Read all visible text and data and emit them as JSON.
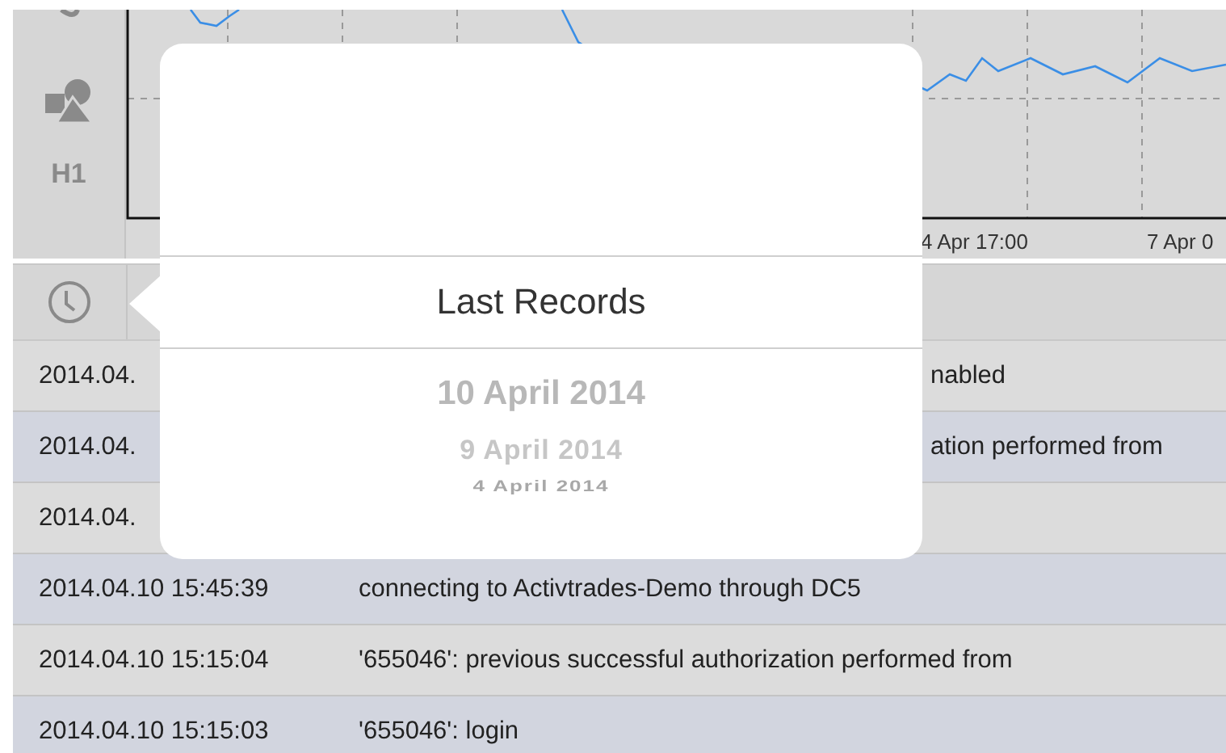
{
  "sidebar": {
    "timeframe": "H1"
  },
  "chart": {
    "x_labels": [
      "4 Apr 17:00",
      "7 Apr 0"
    ]
  },
  "popover": {
    "title": "Last Records",
    "dates": [
      {
        "label": "10 April 2014"
      },
      {
        "label": "9 April 2014"
      },
      {
        "label": "4 April 2014"
      }
    ]
  },
  "journal": [
    {
      "kind": "partial",
      "time": "2014.04.",
      "message": "nabled"
    },
    {
      "kind": "partial",
      "time": "2014.04.",
      "message": "ation performed from"
    },
    {
      "time": "2014.04."
    },
    {
      "kind": "full",
      "time": "2014.04.10 15:45:39",
      "message": "connecting to Activtrades-Demo through DC5"
    },
    {
      "kind": "full",
      "time": "2014.04.10 15:15:04",
      "message": "'655046': previous successful authorization performed from"
    },
    {
      "kind": "full",
      "time": "2014.04.10 15:15:03",
      "message": "'655046': login"
    }
  ]
}
